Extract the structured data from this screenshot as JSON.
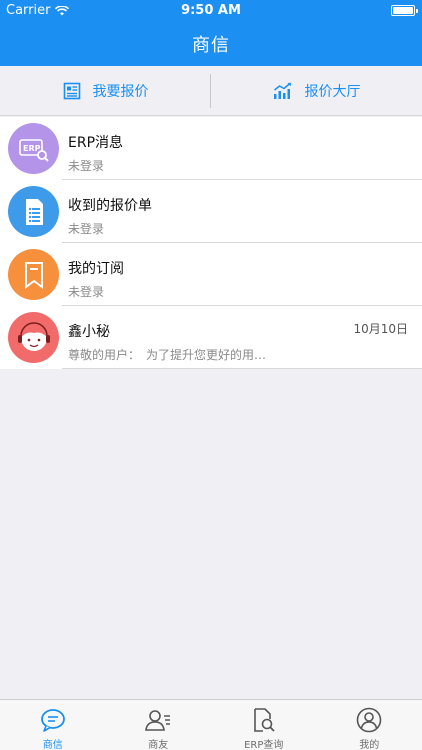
{
  "status_bar": {
    "carrier": "Carrier",
    "time": "9:50 AM"
  },
  "nav": {
    "title": "商信"
  },
  "segments": [
    {
      "label": "我要报价",
      "icon": "quote-sheet-icon"
    },
    {
      "label": "报价大厅",
      "icon": "chart-trend-icon"
    }
  ],
  "messages": [
    {
      "name": "ERP消息",
      "subtitle": "未登录",
      "date": "",
      "icon": "erp-search-icon",
      "color": "#b394e8"
    },
    {
      "name": "收到的报价单",
      "subtitle": "未登录",
      "date": "",
      "icon": "document-list-icon",
      "color": "#3d9be9"
    },
    {
      "name": "我的订阅",
      "subtitle": "未登录",
      "date": "",
      "icon": "bookmark-icon",
      "color": "#f7903c"
    },
    {
      "name": "鑫小秘",
      "subtitle": " 尊敬的用户：　为了提升您更好的用…",
      "date": "10月10日",
      "icon": "assistant-avatar-icon",
      "color": "#f26b6b"
    }
  ],
  "tabs": [
    {
      "label": "商信",
      "icon": "chat-bubble-icon",
      "active": true
    },
    {
      "label": "商友",
      "icon": "contacts-icon",
      "active": false
    },
    {
      "label": "ERP查询",
      "icon": "erp-query-icon",
      "active": false
    },
    {
      "label": "我的",
      "icon": "profile-icon",
      "active": false
    }
  ],
  "colors": {
    "brand": "#1b8ff2",
    "background": "#efeff4"
  }
}
